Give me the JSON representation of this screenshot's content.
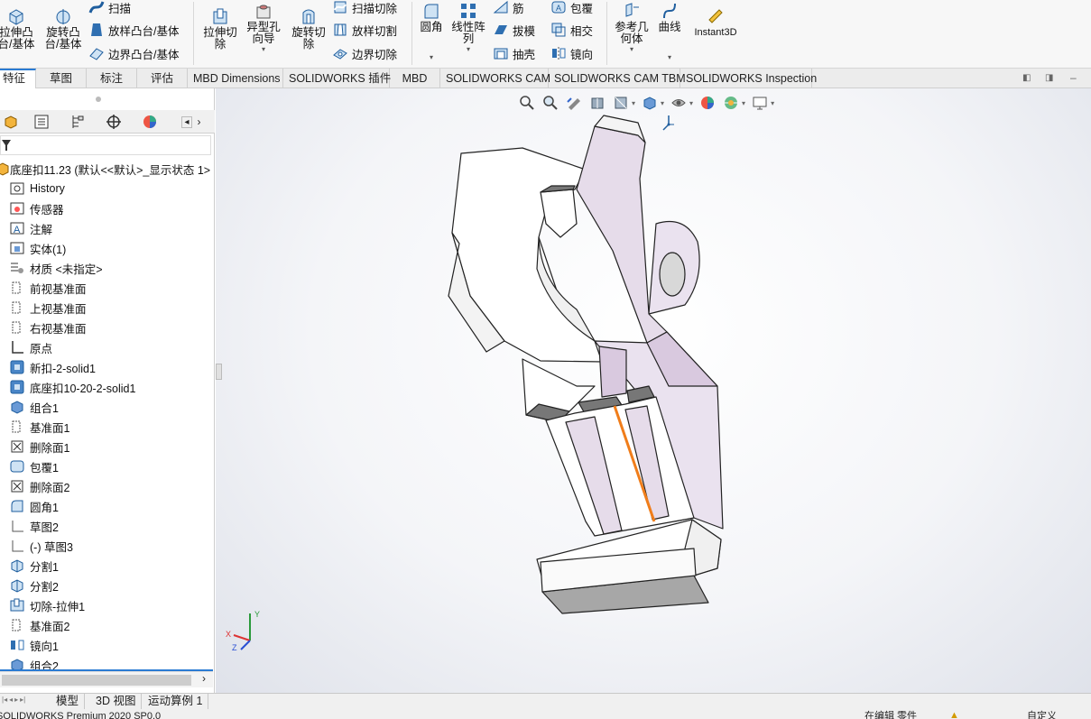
{
  "ribbon": {
    "extrude_boss": "拉伸凸\n台/基体",
    "revolve_boss": "旋转凸\n台/基体",
    "sweep": "扫描",
    "loft_boss": "放样凸台/基体",
    "boundary_boss": "边界凸台/基体",
    "extrude_cut": "拉伸切\n除",
    "hole_wizard": "异型孔\n向导",
    "revolve_cut": "旋转切\n除",
    "sweep_cut": "扫描切除",
    "loft_cut": "放样切割",
    "boundary_cut": "边界切除",
    "fillet": "圆角",
    "linear_pattern": "线性阵\n列",
    "rib": "筋",
    "draft": "拔模",
    "shell": "抽壳",
    "wrap": "包覆",
    "intersect": "相交",
    "mirror": "镜向",
    "ref_geometry": "参考几\n何体",
    "curves": "曲线",
    "instant3d": "Instant3D"
  },
  "tabs": [
    "特征",
    "草图",
    "标注",
    "评估",
    "MBD Dimensions",
    "SOLIDWORKS 插件",
    "MBD",
    "SOLIDWORKS CAM",
    "SOLIDWORKS CAM TBM",
    "SOLIDWORKS Inspection"
  ],
  "tree": {
    "root": "底座扣11.23  (默认<<默认>_显示状态 1>",
    "items": [
      "History",
      "传感器",
      "注解",
      "实体(1)",
      "材质 <未指定>",
      "前视基准面",
      "上视基准面",
      "右视基准面",
      "原点",
      "新扣-2-solid1",
      "底座扣10-20-2-solid1",
      "组合1",
      "基准面1",
      "删除面1",
      "包覆1",
      "删除面2",
      "圆角1",
      "草图2",
      "(-) 草图3",
      "分割1",
      "分割2",
      "切除-拉伸1",
      "基准面2",
      "镜向1",
      "组合2"
    ]
  },
  "bottom_tabs": [
    "模型",
    "3D 视图",
    "运动算例 1"
  ],
  "status": {
    "app": "SOLIDWORKS Premium 2020 SP0.0",
    "edit": "在编辑 零件",
    "custom": "自定义"
  },
  "triad": {
    "x": "X",
    "y": "Y",
    "z": "Z"
  },
  "colors": {
    "accent": "#2a7bd3",
    "part_lilac": "#e6dcea",
    "edge_orange": "#f07d1a"
  }
}
